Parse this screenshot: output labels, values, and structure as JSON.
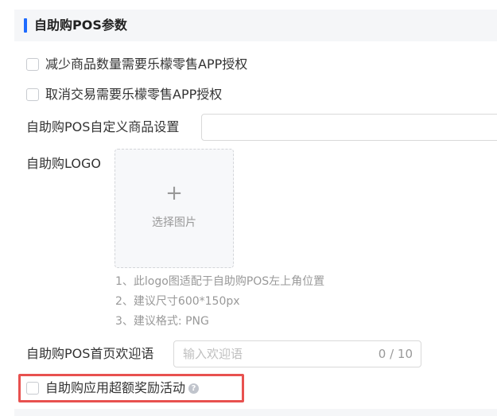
{
  "section": {
    "title": "自助购POS参数",
    "accent_color": "#1f6bff"
  },
  "checkboxes": {
    "reduce_qty": {
      "label": "减少商品数量需要乐檬零售APP授权",
      "checked": false
    },
    "cancel_trade": {
      "label": "取消交易需要乐檬零售APP授权",
      "checked": false
    },
    "overpay_reward": {
      "label": "自助购应用超额奖励活动",
      "checked": false
    }
  },
  "custom_goods": {
    "label": "自助购POS自定义商品设置",
    "value": ""
  },
  "logo": {
    "label": "自助购LOGO",
    "upload_icon": "plus-icon",
    "upload_glyph": "+",
    "upload_text": "选择图片",
    "hints": [
      "1、此logo图适配于自助购POS左上角位置",
      "2、建议尺寸600*150px",
      "3、建议格式: PNG"
    ]
  },
  "welcome": {
    "label": "自助购POS首页欢迎语",
    "placeholder": "输入欢迎语",
    "counter": "0 / 10"
  },
  "help": {
    "icon": "question-circle-icon",
    "glyph": "?"
  },
  "highlight_color": "#e8514f"
}
